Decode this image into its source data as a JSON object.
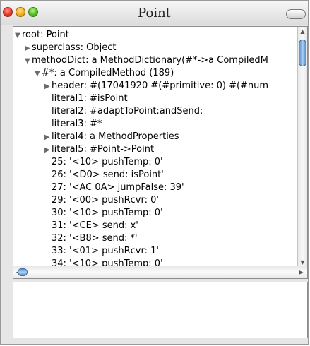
{
  "window": {
    "title": "Point"
  },
  "tree": {
    "rows": [
      {
        "text": "root: Point",
        "indent": 0,
        "arrow": "down"
      },
      {
        "text": "superclass: Object",
        "indent": 1,
        "arrow": "right"
      },
      {
        "text": "methodDict: a MethodDictionary(#*->a CompiledM",
        "indent": 1,
        "arrow": "down"
      },
      {
        "text": "#*: a CompiledMethod (189)",
        "indent": 2,
        "arrow": "down"
      },
      {
        "text": "header: #(17041920 #(#primitive: 0) #(#num",
        "indent": 3,
        "arrow": "right"
      },
      {
        "text": "literal1: #isPoint",
        "indent": 3,
        "arrow": ""
      },
      {
        "text": "literal2: #adaptToPoint:andSend:",
        "indent": 3,
        "arrow": ""
      },
      {
        "text": "literal3: #*",
        "indent": 3,
        "arrow": ""
      },
      {
        "text": "literal4: a MethodProperties",
        "indent": 3,
        "arrow": "right"
      },
      {
        "text": "literal5: #Point->Point",
        "indent": 3,
        "arrow": "right"
      },
      {
        "text": "25: '<10> pushTemp: 0'",
        "indent": 3,
        "arrow": ""
      },
      {
        "text": "26: '<D0> send: isPoint'",
        "indent": 3,
        "arrow": ""
      },
      {
        "text": "27: '<AC 0A> jumpFalse: 39'",
        "indent": 3,
        "arrow": ""
      },
      {
        "text": "29: '<00> pushRcvr: 0'",
        "indent": 3,
        "arrow": ""
      },
      {
        "text": "30: '<10> pushTemp: 0'",
        "indent": 3,
        "arrow": ""
      },
      {
        "text": "31: '<CE> send: x'",
        "indent": 3,
        "arrow": ""
      },
      {
        "text": "32: '<B8> send: *'",
        "indent": 3,
        "arrow": ""
      },
      {
        "text": "33: '<01> pushRcvr: 1'",
        "indent": 3,
        "arrow": ""
      },
      {
        "text": "34: '<10> pushTemp: 0'",
        "indent": 3,
        "arrow": ""
      }
    ]
  },
  "icons": {
    "expanded": "▼",
    "collapsed": "▶"
  }
}
